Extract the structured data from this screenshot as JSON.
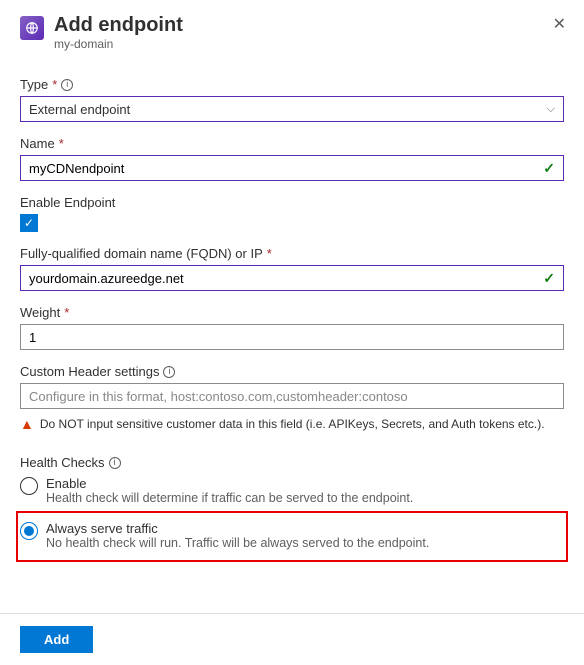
{
  "header": {
    "title": "Add endpoint",
    "subtitle": "my-domain"
  },
  "type": {
    "label": "Type",
    "value": "External endpoint"
  },
  "name": {
    "label": "Name",
    "value": "myCDNendpoint"
  },
  "enable": {
    "label": "Enable Endpoint",
    "checked": true
  },
  "fqdn": {
    "label": "Fully-qualified domain name (FQDN) or IP",
    "value": "yourdomain.azureedge.net"
  },
  "weight": {
    "label": "Weight",
    "value": "1"
  },
  "customHeader": {
    "label": "Custom Header settings",
    "placeholder": "Configure in this format, host:contoso.com,customheader:contoso"
  },
  "warning": "Do NOT input sensitive customer data in this field (i.e. APIKeys, Secrets, and Auth tokens etc.).",
  "healthChecks": {
    "label": "Health Checks",
    "options": {
      "enable": {
        "label": "Enable",
        "desc": "Health check will determine if traffic can be served to the endpoint."
      },
      "always": {
        "label": "Always serve traffic",
        "desc": "No health check will run. Traffic will be always served to the endpoint."
      }
    }
  },
  "footer": {
    "add": "Add"
  }
}
